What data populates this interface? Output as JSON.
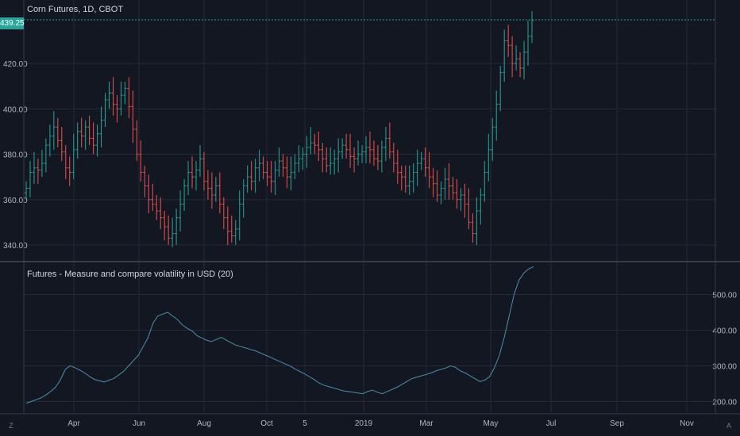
{
  "chart_data": [
    {
      "type": "ohlc",
      "title": "Corn Futures, 1D, CBOT",
      "last_price_label": "439.25",
      "last_price": 439.25,
      "ylim": [
        333,
        448
      ],
      "y_ticks": [
        340,
        360,
        380,
        400,
        420
      ],
      "y_tick_labels": [
        "340.00",
        "360.00",
        "380.00",
        "400.00",
        "420.00"
      ],
      "x_tick_labels": [
        "Apr",
        "Jun",
        "Aug",
        "Oct",
        "5",
        "2019",
        "Mar",
        "May",
        "Jul",
        "Sep",
        "Nov"
      ],
      "series": [
        {
          "values": [
            365,
            372,
            374,
            373,
            376,
            384,
            388,
            392,
            386,
            381,
            374,
            372,
            382,
            390,
            388,
            392,
            387,
            384,
            389,
            395,
            404,
            407,
            402,
            400,
            406,
            409,
            401,
            391,
            380,
            372,
            366,
            360,
            358,
            355,
            352,
            348,
            343,
            345,
            352,
            358,
            366,
            372,
            370,
            373,
            378,
            368,
            365,
            362,
            366,
            358,
            352,
            346,
            344,
            347,
            358,
            366,
            370,
            368,
            374,
            376,
            372,
            370,
            368,
            373,
            377,
            374,
            370,
            372,
            376,
            378,
            380,
            383,
            385,
            384,
            382,
            378,
            375,
            376,
            378,
            381,
            384,
            382,
            379,
            378,
            380,
            381,
            383,
            382,
            378,
            377,
            383,
            387,
            381,
            376,
            372,
            370,
            366,
            368,
            372,
            376,
            378,
            374,
            370,
            367,
            362,
            365,
            369,
            366,
            363,
            360,
            362,
            358,
            350,
            345,
            355,
            362,
            372,
            382,
            392,
            402,
            416,
            430,
            428,
            420,
            422,
            418,
            425,
            432,
            439
          ]
        }
      ]
    },
    {
      "type": "line",
      "title": "Futures - Measure and compare volatility in USD (20)",
      "ylim": [
        170,
        590
      ],
      "y_ticks": [
        200,
        300,
        400,
        500
      ],
      "y_tick_labels": [
        "200.00",
        "300.00",
        "400.00",
        "500.00"
      ],
      "x_tick_labels": [
        "Apr",
        "Jun",
        "Aug",
        "Oct",
        "5",
        "2019",
        "Mar",
        "May",
        "Jul",
        "Sep",
        "Nov"
      ],
      "series": [
        {
          "color": "#4a8fb0",
          "values": [
            195,
            200,
            205,
            210,
            218,
            228,
            240,
            260,
            290,
            300,
            295,
            288,
            280,
            270,
            262,
            258,
            255,
            260,
            265,
            275,
            285,
            300,
            315,
            330,
            355,
            380,
            420,
            440,
            445,
            450,
            440,
            430,
            415,
            405,
            398,
            385,
            378,
            372,
            368,
            374,
            380,
            372,
            365,
            358,
            354,
            350,
            346,
            342,
            336,
            330,
            325,
            318,
            312,
            306,
            300,
            292,
            285,
            278,
            270,
            262,
            252,
            246,
            242,
            238,
            234,
            230,
            228,
            226,
            224,
            222,
            228,
            232,
            226,
            222,
            228,
            234,
            240,
            248,
            256,
            264,
            268,
            272,
            276,
            280,
            286,
            290,
            294,
            300,
            296,
            286,
            280,
            272,
            264,
            256,
            260,
            270,
            295,
            330,
            380,
            440,
            500,
            540,
            560,
            572,
            578
          ]
        }
      ]
    }
  ],
  "corner_icons": {
    "bottom_left": "Z",
    "bottom_right": "A"
  },
  "colors": {
    "up": "#26a69a",
    "down": "#ef5350",
    "price_line": "#26a69a",
    "volatility": "#4a8fb0",
    "grid": "#262a35"
  }
}
